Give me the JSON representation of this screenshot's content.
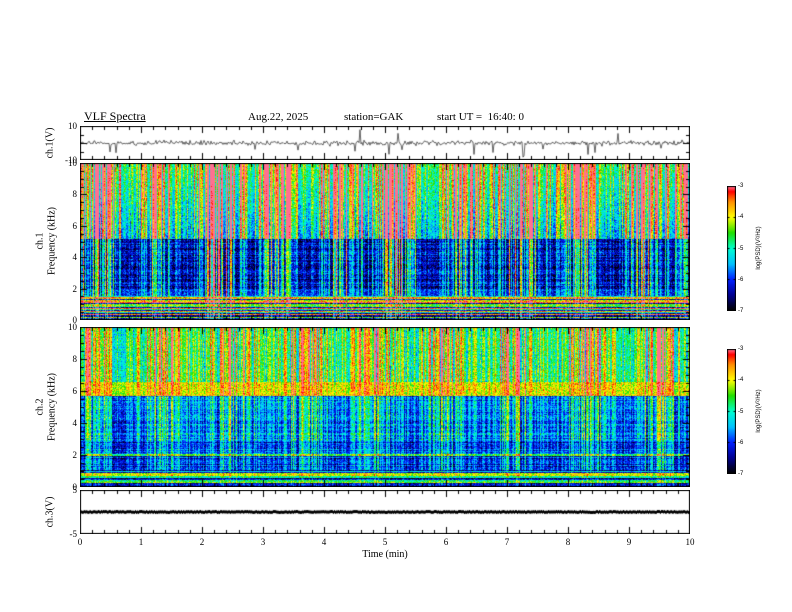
{
  "header": {
    "title": "VLF Spectra",
    "date": "Aug.22, 2025",
    "station": "station=GAK",
    "start_ut": "start UT =  16:40: 0"
  },
  "x_axis": {
    "label": "Time (min)",
    "min": 0,
    "max": 10,
    "ticks": [
      0,
      1,
      2,
      3,
      4,
      5,
      6,
      7,
      8,
      9,
      10
    ]
  },
  "colormap": {
    "stops": [
      [
        0.0,
        "#000000"
      ],
      [
        0.125,
        "#000090"
      ],
      [
        0.25,
        "#0020ff"
      ],
      [
        0.375,
        "#00c0ff"
      ],
      [
        0.5,
        "#00ffd0"
      ],
      [
        0.625,
        "#20e000"
      ],
      [
        0.75,
        "#ffff00"
      ],
      [
        0.875,
        "#ff9000"
      ],
      [
        0.96,
        "#ff0000"
      ],
      [
        1.0,
        "#ff7090"
      ]
    ]
  },
  "colorbars": [
    {
      "label": "log(PSD)(V²/Hz)",
      "ticks": [
        -3,
        -4,
        -5,
        -6,
        -7
      ],
      "min": -7,
      "max": -3
    },
    {
      "label": "log(PSD)(V²/Hz)",
      "ticks": [
        -3,
        -4,
        -5,
        -6,
        -7
      ],
      "min": -7,
      "max": -3
    }
  ],
  "chart_data": [
    {
      "type": "line",
      "name": "ch1-waveform",
      "ylabel": "ch.1(V)",
      "ylim": [
        -10,
        10
      ],
      "yticks": [
        10,
        -10
      ],
      "xlim": [
        0,
        10
      ],
      "description": "Broadband noise waveform centered on 0 V with frequent impulsive spikes reaching about ±9 V across the full 10 minutes."
    },
    {
      "type": "heatmap",
      "name": "ch1-spectrogram",
      "channel": "ch.1",
      "ylabel": "Frequency (kHz)",
      "ylim": [
        0,
        10
      ],
      "yticks": [
        0,
        2,
        4,
        6,
        8,
        10
      ],
      "xlim": [
        0,
        10
      ],
      "zlabel": "log(PSD)(V²/Hz)",
      "zlim": [
        -7,
        -3
      ],
      "features": [
        "dense vertical sferic streaks (red/yellow) strongest above 5 kHz",
        "dark blue low-power region roughly 2-5 kHz with cyan/green vertical lines",
        "intense multicolored horizontal emission bands below ~1.5 kHz",
        "occasional strong streaks spanning the whole 0-10 kHz band"
      ]
    },
    {
      "type": "heatmap",
      "name": "ch2-spectrogram",
      "channel": "ch.2",
      "ylabel": "Frequency (kHz)",
      "ylim": [
        0,
        10
      ],
      "yticks": [
        0,
        2,
        4,
        6,
        8,
        10
      ],
      "xlim": [
        0,
        10
      ],
      "zlabel": "log(PSD)(V²/Hz)",
      "zlim": [
        -7,
        -3
      ],
      "features": [
        "green/cyan speckled background above ~6.5 kHz with yellow-red vertical streaks",
        "persistent bright yellow horizontal band near 6 kHz",
        "blue region 1-5.5 kHz crossed by green vertical lines and faint horizontal striping",
        "bright banded emissions below ~1 kHz"
      ]
    },
    {
      "type": "line",
      "name": "ch3-waveform",
      "ylabel": "ch.3(V)",
      "ylim": [
        -5,
        5
      ],
      "yticks": [
        5,
        -5
      ],
      "xlim": [
        0,
        10
      ],
      "description": "Flat signal: constant thick trace at 0 V for the whole record."
    }
  ]
}
